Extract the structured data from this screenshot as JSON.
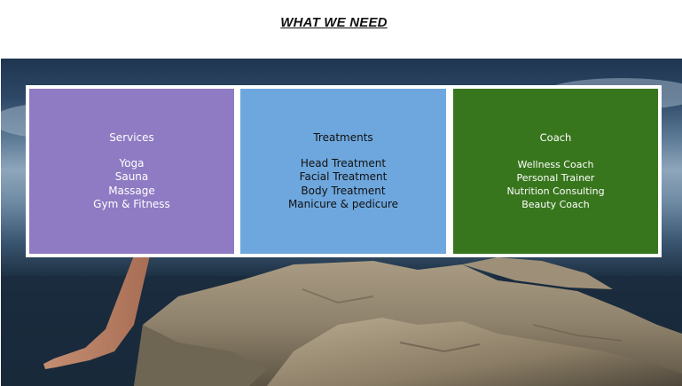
{
  "section": {
    "title": "WHAT WE NEED"
  },
  "cards": [
    {
      "title": "Services",
      "items": [
        "Yoga",
        "Sauna",
        "Massage",
        "Gym & Fitness"
      ],
      "color": "#8e7bc3"
    },
    {
      "title": "Treatments",
      "items": [
        "Head Treatment",
        "Facial Treatment",
        "Body Treatment",
        "Manicure & pedicure"
      ],
      "color": "#6ea7dd"
    },
    {
      "title": "Coach",
      "items": [
        "Wellness Coach",
        "Personal Trainer",
        "Nutrition Consulting",
        "Beauty Coach"
      ],
      "color": "#38761d"
    }
  ]
}
